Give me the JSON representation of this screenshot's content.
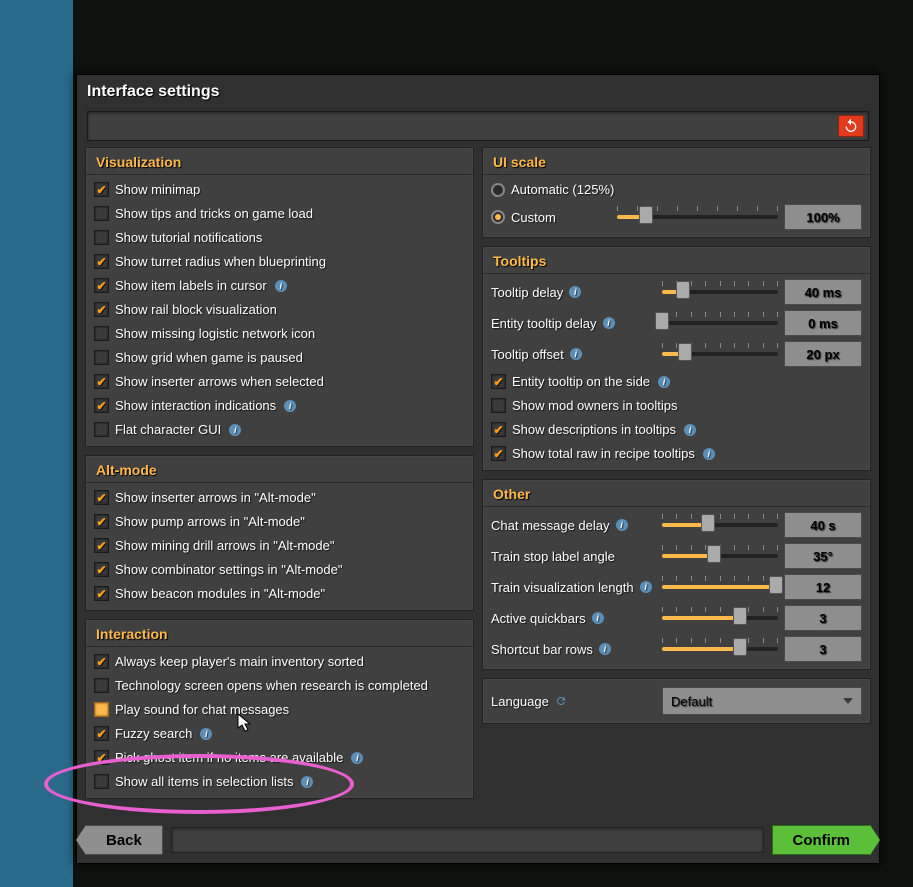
{
  "title": "Interface settings",
  "visualization": {
    "header": "Visualization",
    "items": [
      {
        "label": "Show minimap",
        "checked": true,
        "info": false
      },
      {
        "label": "Show tips and tricks on game load",
        "checked": false,
        "info": false
      },
      {
        "label": "Show tutorial notifications",
        "checked": false,
        "info": false
      },
      {
        "label": "Show turret radius when blueprinting",
        "checked": true,
        "info": false
      },
      {
        "label": "Show item labels in cursor",
        "checked": true,
        "info": true
      },
      {
        "label": "Show rail block visualization",
        "checked": true,
        "info": false
      },
      {
        "label": "Show missing logistic network icon",
        "checked": false,
        "info": false
      },
      {
        "label": "Show grid when game is paused",
        "checked": false,
        "info": false
      },
      {
        "label": "Show inserter arrows when selected",
        "checked": true,
        "info": false
      },
      {
        "label": "Show interaction indications",
        "checked": true,
        "info": true
      },
      {
        "label": "Flat character GUI",
        "checked": false,
        "info": true
      }
    ]
  },
  "altmode": {
    "header": "Alt-mode",
    "items": [
      {
        "label": "Show inserter arrows in \"Alt-mode\"",
        "checked": true
      },
      {
        "label": "Show pump arrows in \"Alt-mode\"",
        "checked": true
      },
      {
        "label": "Show mining drill arrows in \"Alt-mode\"",
        "checked": true
      },
      {
        "label": "Show combinator settings in \"Alt-mode\"",
        "checked": true
      },
      {
        "label": "Show beacon modules in \"Alt-mode\"",
        "checked": true
      }
    ]
  },
  "interaction": {
    "header": "Interaction",
    "items": [
      {
        "label": "Always keep player's main inventory sorted",
        "checked": true,
        "info": false,
        "hover": false
      },
      {
        "label": "Technology screen opens when research is completed",
        "checked": false,
        "info": false,
        "hover": false
      },
      {
        "label": "Play sound for chat messages",
        "checked": false,
        "info": false,
        "hover": true
      },
      {
        "label": "Fuzzy search",
        "checked": true,
        "info": true,
        "hover": false
      },
      {
        "label": "Pick ghost item if no items are available",
        "checked": true,
        "info": true,
        "hover": false
      },
      {
        "label": "Show all items in selection lists",
        "checked": false,
        "info": true,
        "hover": false
      }
    ]
  },
  "uiscale": {
    "header": "UI scale",
    "auto_label": "Automatic (125%)",
    "custom_label": "Custom",
    "selected": "custom",
    "value": "100%",
    "fill_pct": 18
  },
  "tooltips": {
    "header": "Tooltips",
    "sliders": [
      {
        "label": "Tooltip delay",
        "info": true,
        "value": "40 ms",
        "fill_pct": 18
      },
      {
        "label": "Entity tooltip delay",
        "info": true,
        "value": "0 ms",
        "fill_pct": 0
      },
      {
        "label": "Tooltip offset",
        "info": true,
        "value": "20 px",
        "fill_pct": 20
      }
    ],
    "checks": [
      {
        "label": "Entity tooltip on the side",
        "checked": true,
        "info": true
      },
      {
        "label": "Show mod owners in tooltips",
        "checked": false,
        "info": false
      },
      {
        "label": "Show descriptions in tooltips",
        "checked": true,
        "info": true
      },
      {
        "label": "Show total raw in recipe tooltips",
        "checked": true,
        "info": true
      }
    ]
  },
  "other": {
    "header": "Other",
    "sliders": [
      {
        "label": "Chat message delay",
        "info": true,
        "value": "40 s",
        "fill_pct": 40
      },
      {
        "label": "Train stop label angle",
        "info": false,
        "value": "35°",
        "fill_pct": 45
      },
      {
        "label": "Train visualization length",
        "info": true,
        "value": "12",
        "fill_pct": 98
      },
      {
        "label": "Active quickbars",
        "info": true,
        "value": "3",
        "fill_pct": 67
      },
      {
        "label": "Shortcut bar rows",
        "info": true,
        "value": "3",
        "fill_pct": 67
      }
    ],
    "language_label": "Language",
    "language_value": "Default"
  },
  "footer": {
    "back": "Back",
    "confirm": "Confirm"
  }
}
